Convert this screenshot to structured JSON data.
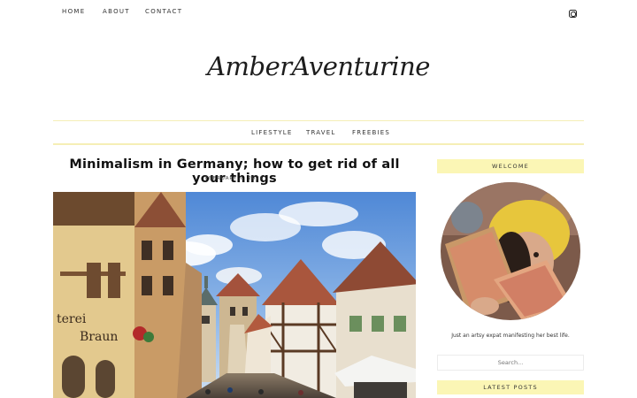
{
  "topnav": {
    "items": [
      "HOME",
      "ABOUT",
      "CONTACT"
    ],
    "social_icon": "instagram-icon"
  },
  "site": {
    "logo_text": "AmberAventurine"
  },
  "categories": [
    "LIFESTYLE",
    "TRAVEL",
    "FREEBIES"
  ],
  "post": {
    "title": "Minimalism in Germany; how to get rid of all your things",
    "date": "FEBRUARY 7, 2026",
    "hero_sign_1": "terei",
    "hero_sign_2": "Braun"
  },
  "sidebar": {
    "welcome_heading": "WELCOME",
    "tagline": "Just an artsy expat manifesting her best life.",
    "search_placeholder": "Search...",
    "latest_heading": "LATEST POSTS"
  },
  "colors": {
    "accent_yellow": "#fbf6b5",
    "divider_yellow": "#f5efb6",
    "text": "#222222"
  }
}
